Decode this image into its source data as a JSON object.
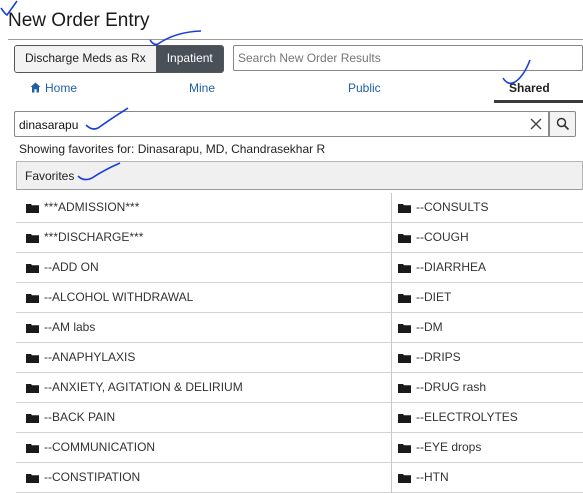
{
  "title": "New Order Entry",
  "segmented": {
    "options": [
      "Discharge Meds as Rx",
      "Inpatient"
    ],
    "active": "Inpatient"
  },
  "search_results": {
    "placeholder": "Search New Order Results",
    "value": ""
  },
  "tabs": [
    {
      "label": "Home",
      "icon": "home-icon"
    },
    {
      "label": "Mine"
    },
    {
      "label": "Public"
    },
    {
      "label": "Shared",
      "active": true
    }
  ],
  "favorites_search": {
    "value": "dinasarapu"
  },
  "showing_text": "Showing favorites for: Dinasarapu, MD, Chandrasekhar R",
  "favorites_header": "Favorites",
  "folders_left": [
    "***ADMISSION***",
    "***DISCHARGE***",
    "--ADD ON",
    "--ALCOHOL WITHDRAWAL",
    "--AM labs",
    "--ANAPHYLAXIS",
    "--ANXIETY, AGITATION & DELIRIUM",
    "--BACK PAIN",
    "--COMMUNICATION",
    "--CONSTIPATION"
  ],
  "folders_right": [
    "--CONSULTS",
    "--COUGH",
    "--DIARRHEA",
    "--DIET",
    "--DM",
    "--DRIPS",
    "--DRUG rash",
    "--ELECTROLYTES",
    "--EYE drops",
    "--HTN"
  ],
  "colors": {
    "accent_blue": "#1e5fa6",
    "active_segment": "#4a5058",
    "annotation_ink": "#1a3fd8"
  }
}
